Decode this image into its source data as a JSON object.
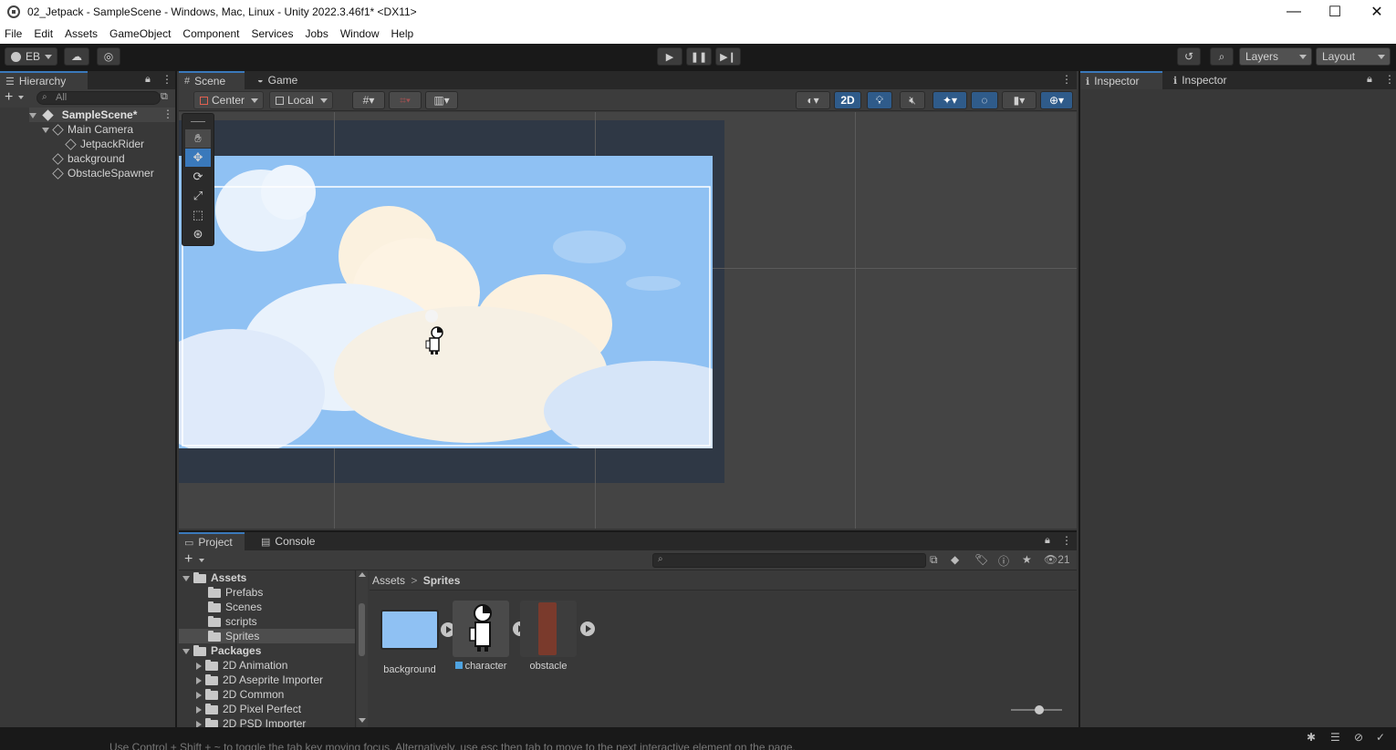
{
  "window": {
    "title": "02_Jetpack - SampleScene - Windows, Mac, Linux - Unity 2022.3.46f1* <DX11>",
    "minimize": "—",
    "maximize": "☐",
    "close": "✕"
  },
  "menu": [
    "File",
    "Edit",
    "Assets",
    "GameObject",
    "Component",
    "Services",
    "Jobs",
    "Window",
    "Help"
  ],
  "toolbar": {
    "account": "EB",
    "layers": "Layers",
    "layout": "Layout"
  },
  "hierarchy": {
    "tab": "Hierarchy",
    "search_placeholder": "All",
    "scene": "SampleScene*",
    "items": [
      {
        "label": "Main Camera",
        "depth": 1,
        "expanded": true
      },
      {
        "label": "JetpackRider",
        "depth": 2
      },
      {
        "label": "background",
        "depth": 1
      },
      {
        "label": "ObstacleSpawner",
        "depth": 1
      }
    ]
  },
  "scene_view": {
    "tabs": [
      "Scene",
      "Game"
    ],
    "pivot": "Center",
    "space": "Local",
    "mode_2d": "2D"
  },
  "inspector": {
    "tabs": [
      "Inspector",
      "Inspector"
    ]
  },
  "project": {
    "tabs": [
      "Project",
      "Console"
    ],
    "visible_count": "21",
    "tree": [
      {
        "label": "Assets",
        "depth": 0,
        "expanded": true,
        "bold": true
      },
      {
        "label": "Prefabs",
        "depth": 1
      },
      {
        "label": "Scenes",
        "depth": 1
      },
      {
        "label": "scripts",
        "depth": 1
      },
      {
        "label": "Sprites",
        "depth": 1,
        "selected": true
      },
      {
        "label": "Packages",
        "depth": 0,
        "expanded": true,
        "bold": true
      },
      {
        "label": "2D Animation",
        "depth": 1,
        "collapsed": true
      },
      {
        "label": "2D Aseprite Importer",
        "depth": 1,
        "collapsed": true
      },
      {
        "label": "2D Common",
        "depth": 1,
        "collapsed": true
      },
      {
        "label": "2D Pixel Perfect",
        "depth": 1,
        "collapsed": true
      },
      {
        "label": "2D PSD Importer",
        "depth": 1,
        "collapsed": true
      }
    ],
    "breadcrumb": [
      "Assets",
      "Sprites"
    ],
    "assets": [
      {
        "label": "background"
      },
      {
        "label": "character"
      },
      {
        "label": "obstacle"
      }
    ]
  },
  "status_bar": {
    "hint": "Use Control + Shift + ~ to toggle the tab key moving focus. Alternatively, use esc then tab to move to the next interactive element on the page."
  },
  "colors": {
    "accent": "#3a79bb",
    "sky": "#8fc1f3",
    "selection": "#4d4d4d"
  }
}
